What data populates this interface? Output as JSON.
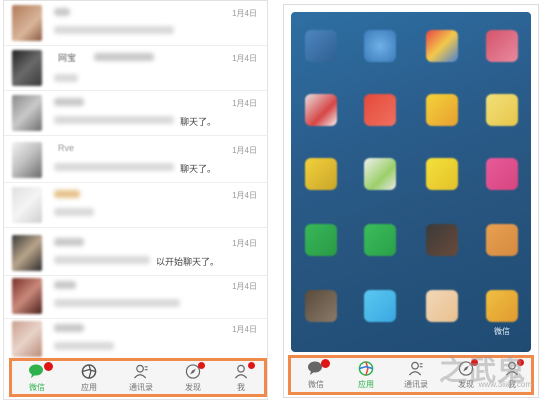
{
  "chat_list": {
    "rows": [
      {
        "date": "1月4日",
        "name": "",
        "message": "",
        "suffix": ""
      },
      {
        "date": "1月4日",
        "name": "网宝",
        "message": "",
        "suffix": ""
      },
      {
        "date": "1月4日",
        "name": "",
        "message": "",
        "suffix": "聊天了。"
      },
      {
        "date": "1月4日",
        "name": "Rve",
        "message": "",
        "suffix": "聊天了。"
      },
      {
        "date": "1月4日",
        "name": "",
        "message": "",
        "suffix": ""
      },
      {
        "date": "1月4日",
        "name": "",
        "message": "",
        "suffix": "以开始聊天了。"
      },
      {
        "date": "1月4日",
        "name": "",
        "message": "",
        "suffix": ""
      },
      {
        "date": "1月4日",
        "name": "",
        "message": "",
        "suffix": ""
      }
    ]
  },
  "tabbar_left": {
    "tabs": [
      {
        "label": "微信",
        "active": true,
        "badge": true
      },
      {
        "label": "应用",
        "active": false,
        "badge": false
      },
      {
        "label": "通讯录",
        "active": false,
        "badge": false
      },
      {
        "label": "发现",
        "active": false,
        "badge": true
      },
      {
        "label": "我",
        "active": false,
        "badge": true
      }
    ]
  },
  "tabbar_right": {
    "tabs": [
      {
        "label": "微信",
        "active": false,
        "badge": true
      },
      {
        "label": "应用",
        "active": true,
        "badge": false
      },
      {
        "label": "通讯录",
        "active": false,
        "badge": false
      },
      {
        "label": "发现",
        "active": false,
        "badge": true
      },
      {
        "label": "我",
        "active": false,
        "badge": true
      }
    ]
  },
  "home_screen": {
    "last_app_label": "微信"
  },
  "watermark": {
    "big": "之武鬼",
    "small": "www.3lian.com"
  },
  "colors": {
    "accent_orange": "#f08a4b",
    "wechat_green": "#2fb24e",
    "badge_red": "#e01515"
  }
}
